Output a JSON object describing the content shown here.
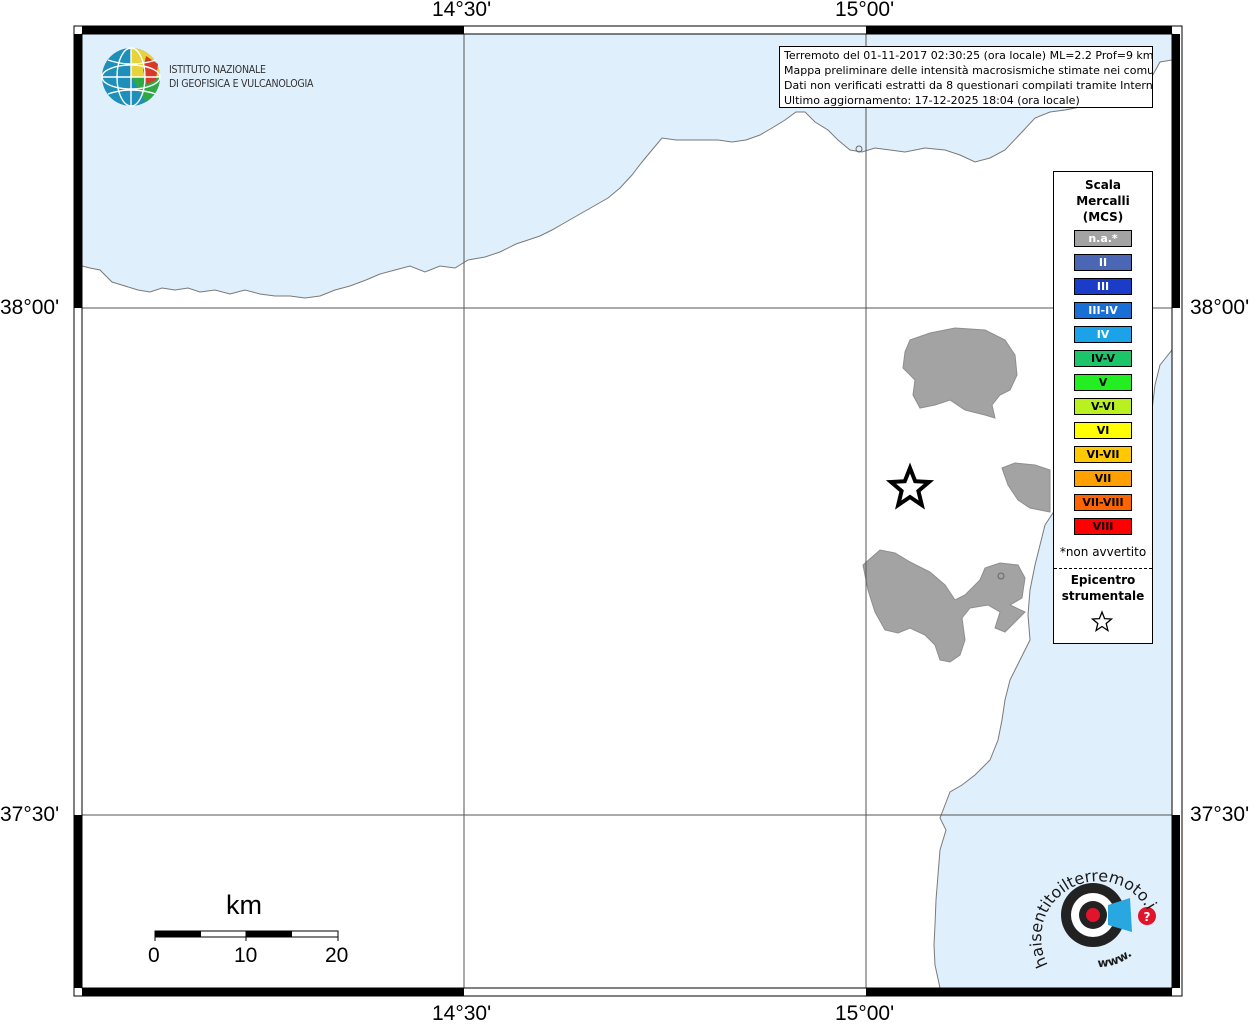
{
  "map": {
    "grid_lon_labels": [
      "14°30'",
      "15°00'"
    ],
    "grid_lat_labels": [
      "38°00'",
      "37°30'"
    ],
    "colors": {
      "sea": "#dfeffb",
      "land": "#ffffff",
      "felt_area": "#a3a3a3",
      "coast": "#7a7a7a"
    }
  },
  "logo_ingv": {
    "line1": "ISTITUTO NAZIONALE",
    "line2": "DI GEOFISICA E VULCANOLOGIA"
  },
  "info": {
    "line1": "Terremoto del 01-11-2017 02:30:25 (ora locale) ML=2.2 Prof=9 km",
    "line2": "Mappa preliminare delle intensità macrosismiche stimate nei comuni",
    "line3": "Dati non verificati estratti da 8 questionari compilati tramite Internet.",
    "line4": "Ultimo aggiornamento: 17-12-2025 18:04 (ora locale)"
  },
  "legend": {
    "title_line1": "Scala",
    "title_line2": "Mercalli",
    "title_line3": "(MCS)",
    "items": [
      {
        "label": "n.a.*",
        "color": "#a3a3a3",
        "text_color": "#ffffff"
      },
      {
        "label": "II",
        "color": "#4a66b4",
        "text_color": "#ffffff"
      },
      {
        "label": "III",
        "color": "#1b3cc8",
        "text_color": "#ffffff"
      },
      {
        "label": "III-IV",
        "color": "#1a6fd6",
        "text_color": "#ffffff"
      },
      {
        "label": "IV",
        "color": "#1aa3e8",
        "text_color": "#ffffff"
      },
      {
        "label": "IV-V",
        "color": "#1cc46a",
        "text_color": "#000000"
      },
      {
        "label": "V",
        "color": "#22ee22",
        "text_color": "#000000"
      },
      {
        "label": "V-VI",
        "color": "#b8f020",
        "text_color": "#000000"
      },
      {
        "label": "VI",
        "color": "#ffff00",
        "text_color": "#000000"
      },
      {
        "label": "VI-VII",
        "color": "#ffc800",
        "text_color": "#000000"
      },
      {
        "label": "VII",
        "color": "#ffa000",
        "text_color": "#000000"
      },
      {
        "label": "VII-VIII",
        "color": "#ff6400",
        "text_color": "#000000"
      },
      {
        "label": "VIII",
        "color": "#ff0000",
        "text_color": "#000000"
      }
    ],
    "note": "*non avvertito",
    "epicenter_line1": "Epicentro",
    "epicenter_line2": "strumentale"
  },
  "scale_bar": {
    "unit": "km",
    "ticks": [
      "0",
      "10",
      "20"
    ]
  },
  "hsit_logo": {
    "text": "haisentitoilterremoto.it",
    "url_text": "www."
  }
}
